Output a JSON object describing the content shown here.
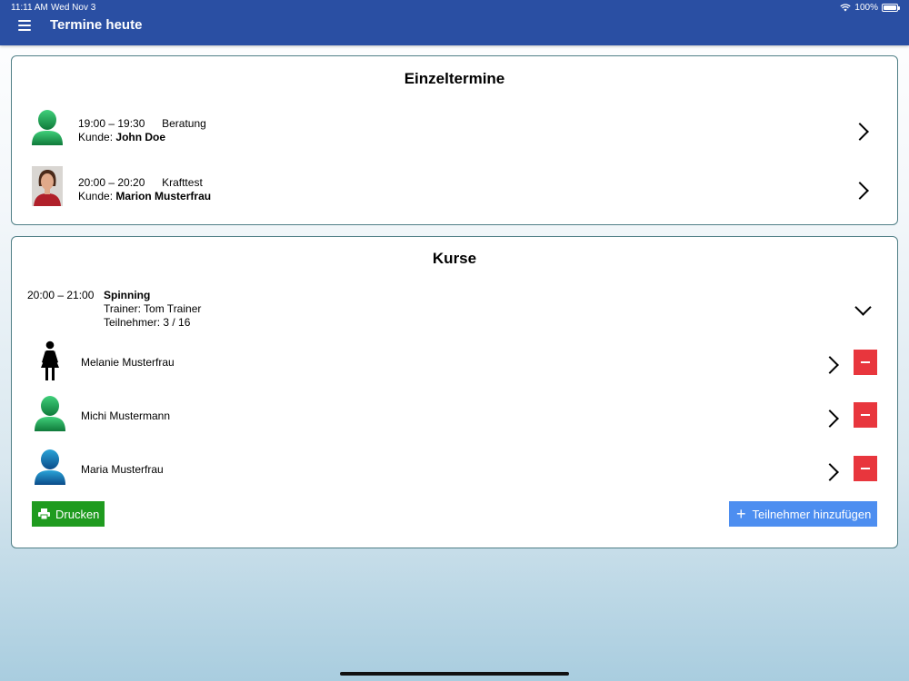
{
  "status_bar": {
    "time": "11:11 AM",
    "date": "Wed Nov 3",
    "battery": "100%"
  },
  "header": {
    "title": "Termine heute",
    "menu_icon": "hamburger-menu-icon",
    "background": "#2a4fa3"
  },
  "einzeltermine": {
    "title": "Einzeltermine",
    "items": [
      {
        "time": "19:00 – 19:30",
        "type": "Beratung",
        "customer_label": "Kunde:",
        "customer": "John Doe",
        "avatar": "green-person-icon"
      },
      {
        "time": "20:00 – 20:20",
        "type": "Krafttest",
        "customer_label": "Kunde:",
        "customer": "Marion Musterfrau",
        "avatar": "photo-avatar"
      }
    ]
  },
  "kurse": {
    "title": "Kurse",
    "course": {
      "time": "20:00 – 21:00",
      "name": "Spinning",
      "trainer": "Trainer: Tom Trainer",
      "participants": "Teilnehmer: 3 / 16"
    },
    "participants": [
      {
        "name": "Melanie Musterfrau",
        "avatar": "female-figure-icon"
      },
      {
        "name": "Michi Mustermann",
        "avatar": "green-person-icon"
      },
      {
        "name": "Maria Musterfrau",
        "avatar": "blue-person-icon"
      }
    ],
    "print_label": "Drucken",
    "add_label": "Teilnehmer hinzufügen"
  },
  "colors": {
    "print_button": "#1f9b1f",
    "add_button": "#4d8ef0",
    "remove_button": "#e8363d",
    "card_border": "#4f7f86"
  }
}
